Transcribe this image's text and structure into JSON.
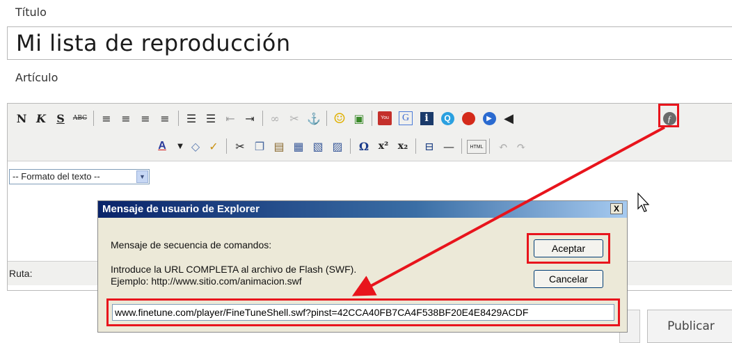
{
  "form": {
    "title_label": "Título",
    "title_value": "Mi lista de reproducción",
    "article_label": "Artículo",
    "publish_label": "Publicar"
  },
  "editor": {
    "toolbar1": [
      {
        "name": "bold-button",
        "glyph": "N"
      },
      {
        "name": "italic-button",
        "glyph": "K"
      },
      {
        "name": "underline-button",
        "glyph": "S"
      },
      {
        "name": "strikethrough-button",
        "glyph": "ABC"
      },
      {
        "name": "align-left-button",
        "glyph": "≡"
      },
      {
        "name": "align-center-button",
        "glyph": "≡"
      },
      {
        "name": "align-right-button",
        "glyph": "≡"
      },
      {
        "name": "justify-button",
        "glyph": "≡"
      },
      {
        "name": "bullet-list-button",
        "glyph": "☰"
      },
      {
        "name": "numbered-list-button",
        "glyph": "☰"
      },
      {
        "name": "outdent-button",
        "glyph": "⇤"
      },
      {
        "name": "indent-button",
        "glyph": "⇥"
      },
      {
        "name": "link-button",
        "glyph": "∞"
      },
      {
        "name": "unlink-button",
        "glyph": "✂"
      },
      {
        "name": "anchor-button",
        "glyph": "⚓"
      },
      {
        "name": "emoticon-button",
        "glyph": "☺"
      },
      {
        "name": "image-button",
        "glyph": "▣"
      },
      {
        "name": "youtube-button",
        "glyph": "You"
      },
      {
        "name": "google-button",
        "glyph": "G"
      },
      {
        "name": "info-button",
        "glyph": "i"
      },
      {
        "name": "quicktime-button",
        "glyph": "Q"
      },
      {
        "name": "real-media-button",
        "glyph": "●"
      },
      {
        "name": "windows-media-button",
        "glyph": "▶"
      },
      {
        "name": "audio-button",
        "glyph": "◀"
      },
      {
        "name": "flash-button",
        "glyph": "ƒ"
      }
    ],
    "format_select": "-- Formato del texto --",
    "path_label": "Ruta:"
  },
  "dialog": {
    "title": "Mensaje de usuario de Explorer",
    "close_glyph": "X",
    "header": "Mensaje de secuencia de comandos:",
    "instruction": "Introduce la URL COMPLETA al archivo de Flash (SWF).",
    "example": "Ejemplo: http://www.sitio.com/animacion.swf",
    "ok_label": "Aceptar",
    "cancel_label": "Cancelar",
    "url_value": "www.finetune.com/player/FineTuneShell.swf?pinst=42CCA40FB7CA4F538BF20E4E8429ACDF"
  },
  "colors": {
    "highlight": "#e8141c",
    "dialog_title_bar": "#0a246a",
    "toolbar_bg": "#f0f0ee"
  }
}
